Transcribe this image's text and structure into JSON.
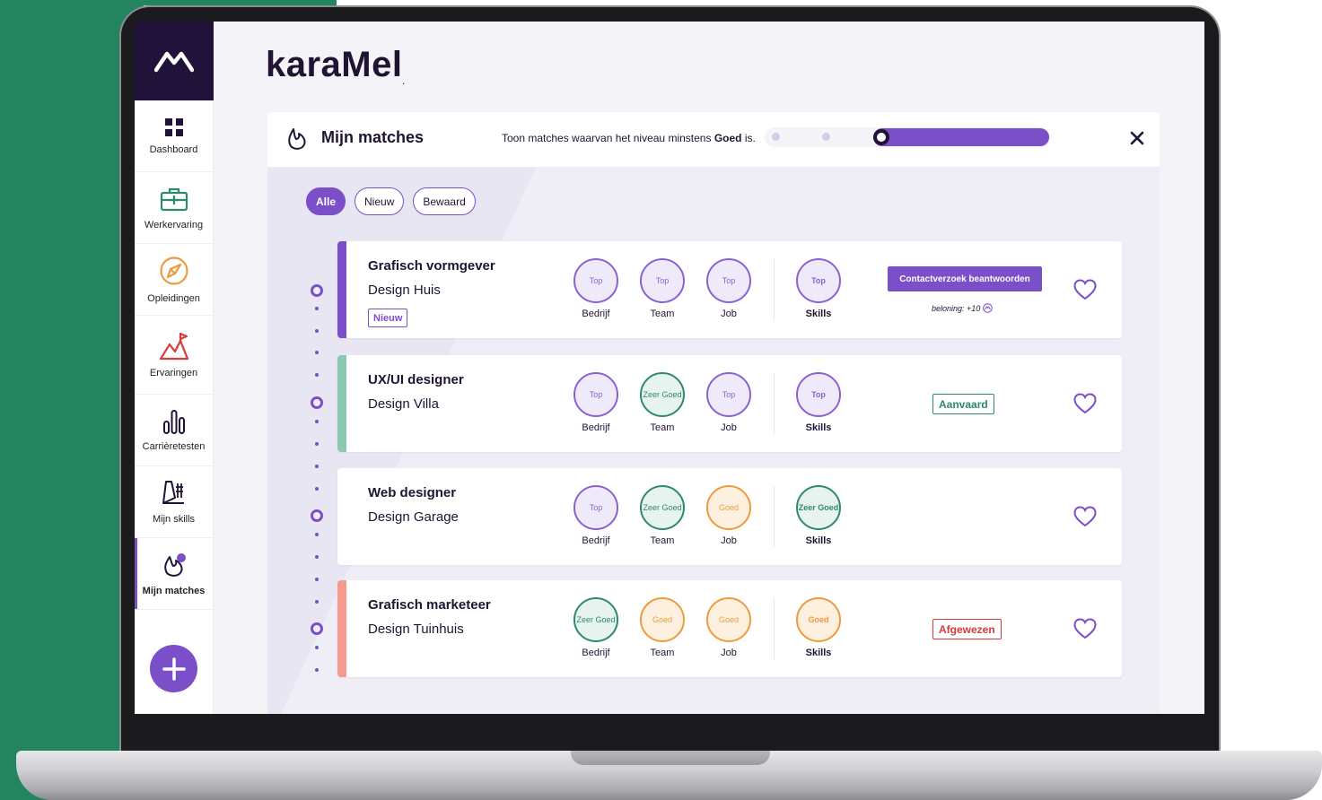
{
  "brand": {
    "name": "karaMel",
    "trademark": "."
  },
  "colors": {
    "accent": "#7b4fc8",
    "top": "#8a62d0",
    "zeer_goed": "#2f8a6a",
    "goed": "#ee9a3f",
    "rejected": "#d93a3a",
    "nav_dark": "#201238"
  },
  "sidebar": {
    "items": [
      {
        "label": "Dashboard",
        "icon": "grid-icon"
      },
      {
        "label": "Werkervaring",
        "icon": "briefcase-icon"
      },
      {
        "label": "Opleidingen",
        "icon": "compass-icon"
      },
      {
        "label": "Ervaringen",
        "icon": "mountain-flag-icon"
      },
      {
        "label": "Carrièretesten",
        "icon": "bars-icon"
      },
      {
        "label": "Mijn skills",
        "icon": "skills-icon"
      },
      {
        "label": "Mijn matches",
        "icon": "flame-icon"
      }
    ],
    "add_label": "+"
  },
  "header": {
    "title": "Mijn matches",
    "desc_prefix": "Toon matches waarvan het niveau minstens",
    "desc_level": "Goed",
    "desc_suffix": "is.",
    "slider_level": 3,
    "slider_levels": 4
  },
  "filters": [
    "Alle",
    "Nieuw",
    "Bewaard"
  ],
  "active_filter": "Alle",
  "score_labels": [
    "Bedrijf",
    "Team",
    "Job",
    "Skills"
  ],
  "matches": [
    {
      "job": "Grafisch vormgever",
      "company": "Design Huis",
      "tag": "Nieuw",
      "accent": "#7b4fc8",
      "scores": [
        "Top",
        "Top",
        "Top",
        "Top"
      ],
      "action": "Contactverzoek beantwoorden",
      "reward": "beloning: +10"
    },
    {
      "job": "UX/UI designer",
      "company": "Design Villa",
      "accent": "#8cc7b1",
      "scores": [
        "Top",
        "Zeer Goed",
        "Top",
        "Top"
      ],
      "status": "Aanvaard"
    },
    {
      "job": "Web designer",
      "company": "Design Garage",
      "accent": "#ffffff",
      "scores": [
        "Top",
        "Zeer Goed",
        "Goed",
        "Zeer Goed"
      ]
    },
    {
      "job": "Grafisch marketeer",
      "company": "Design Tuinhuis",
      "accent": "#f59a8f",
      "scores": [
        "Zeer Goed",
        "Goed",
        "Goed",
        "Goed"
      ],
      "status": "Afgewezen"
    }
  ]
}
